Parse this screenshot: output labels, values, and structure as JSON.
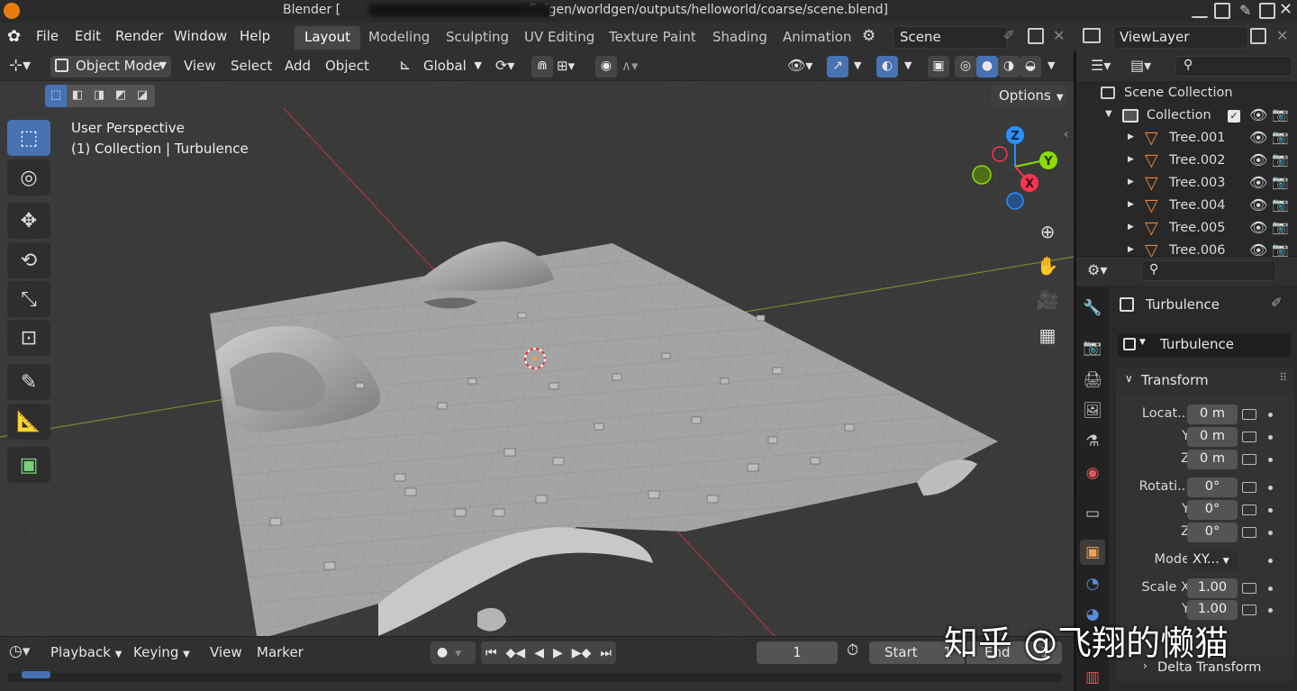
{
  "titlebar": {
    "title_left": "Blender [",
    "title_right": "nfinigen/worldgen/outputs/helloworld/coarse/scene.blend]"
  },
  "menu": {
    "items": [
      "File",
      "Edit",
      "Render",
      "Window",
      "Help"
    ]
  },
  "workspaces": [
    "Layout",
    "Modeling",
    "Sculpting",
    "UV Editing",
    "Texture Paint",
    "Shading",
    "Animation"
  ],
  "active_workspace": "Layout",
  "scene": {
    "name": "Scene"
  },
  "viewlayer": {
    "name": "ViewLayer"
  },
  "viewport_header": {
    "mode": "Object Mode",
    "menus": [
      "View",
      "Select",
      "Add",
      "Object"
    ],
    "transform_orientation": "Global",
    "options_label": "Options"
  },
  "viewport": {
    "perspective": "User Perspective",
    "context": "(1) Collection | Turbulence"
  },
  "gizmo": {
    "z": "Z",
    "y": "Y",
    "x": "X"
  },
  "outliner": {
    "root": "Scene Collection",
    "collection": "Collection",
    "items": [
      "Tree.001",
      "Tree.002",
      "Tree.003",
      "Tree.004",
      "Tree.005",
      "Tree.006"
    ]
  },
  "properties": {
    "object_name": "Turbulence",
    "data_name": "Turbulence",
    "panel": "Transform",
    "location_label": "Locat...",
    "rotation_label": "Rotati...",
    "y_label": "Y",
    "z_label": "Z",
    "location": [
      "0 m",
      "0 m",
      "0 m"
    ],
    "rotation": [
      "0°",
      "0°",
      "0°"
    ],
    "mode_label": "Mode",
    "mode_value": "XY...",
    "scale_label": "Scale X",
    "scale": [
      "1.00",
      "1.00"
    ],
    "delta_panel": "Delta Transform"
  },
  "timeline": {
    "menus": [
      "Playback",
      "Keying",
      "View",
      "Marker"
    ],
    "current_frame": "1",
    "start_label": "Start",
    "start_value": "1",
    "end_label": "End",
    "end_value": "1"
  },
  "watermark": "知乎 @飞翔的懒猫",
  "colors": {
    "accent": "#4772b3",
    "orange": "#e8853a",
    "x_axis": "#ff3352",
    "y_axis": "#8bdc00",
    "z_axis": "#2890ff"
  }
}
